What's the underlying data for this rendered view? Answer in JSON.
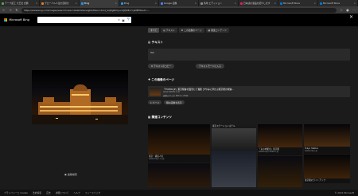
{
  "tabs": [
    {
      "label": "テープ起工 大王社 式典",
      "color": "#4caf50"
    },
    {
      "label": "グローバル人生を目標を",
      "color": "#e67e22"
    },
    {
      "label": "Bing",
      "color": "#2196f3",
      "active": true
    },
    {
      "label": "Bing",
      "color": "#2196f3"
    },
    {
      "label": "Google 画像",
      "color": "#4285f4"
    },
    {
      "label": "各地 エディション",
      "color": "#888"
    },
    {
      "label": "日本語の製品を紹介します",
      "color": "#e91e63"
    },
    {
      "label": "Microsoft Store",
      "color": "#0078d4"
    },
    {
      "label": "Microsoft Store",
      "color": "#0078d4"
    }
  ],
  "address": {
    "url": "https://www.bing.com/images/search?view=detailV2&insightsToken=bcid_SdjDg6KVyucXJQfx8o7i-pM8F8GuCr....."
  },
  "bing": {
    "brand": "Microsoft Bing",
    "brand_colors": [
      "#f25022",
      "#7fba00",
      "#00a4ef",
      "#ffb900"
    ]
  },
  "panel": {
    "tabs": [
      "すべて",
      "テキスト",
      "この画像のページ",
      "関連コンテンツ"
    ],
    "text_heading": "テキスト",
    "text_value": "Tok",
    "copy_button": "テキストのコピー",
    "search_button": "テキストモードに入る",
    "page_heading": "この画像のページ",
    "page_title": "「TOKYO JP」東京駅舎の夜景にて撮影 夕やみに浮かぶ東京駅の駅舎...",
    "page_domain": "www.TOKYO.com",
    "page_meta": "画像のサイズ 3872 x 2592",
    "pages_link": "1 ページ",
    "similar_button": "類似画像を表示",
    "related_heading": "関連コンテンツ",
    "related": [
      {
        "title": "東京・横浜人気",
        "source": "www.tokyo.co.jp"
      },
      {
        "title": "東京ステーションホテル",
        "source": ""
      },
      {
        "title": "「丸の内駅舎」東京駅",
        "source": "www.tokyo-station.jp"
      },
      {
        "title": "Tokyo Station",
        "source": "www.tokyo.jp"
      },
      {
        "title": "東京駅のライトアップ",
        "source": "www.tokyo.org"
      }
    ]
  },
  "zoom_label": "画像検索",
  "footer": {
    "links": [
      "プライバシーと Cookie",
      "法的情報",
      "広告",
      "詳細について",
      "ヘルプ",
      "フィードバック"
    ],
    "copyright": "© 2021 Microsoft"
  }
}
